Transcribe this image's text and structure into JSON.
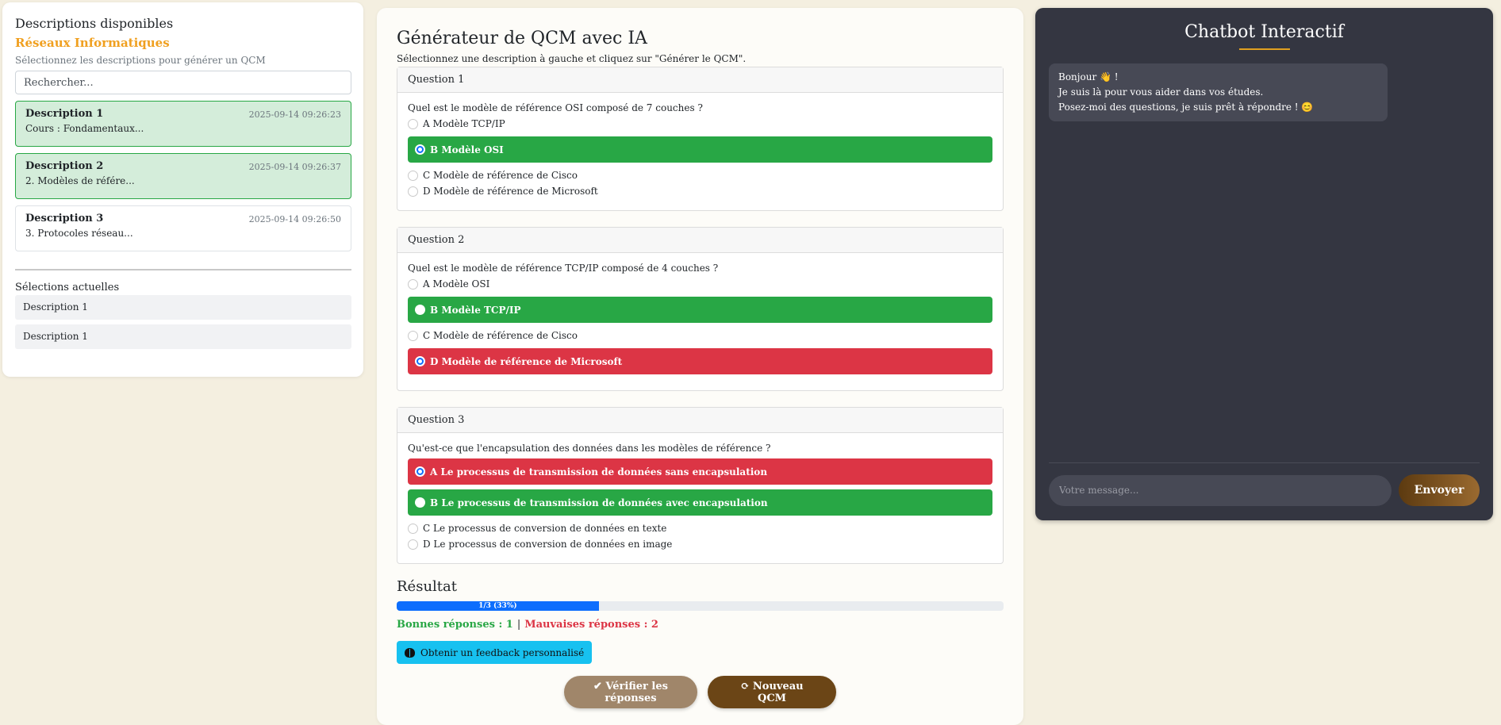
{
  "left": {
    "title": "Descriptions disponibles",
    "subject": "Réseaux Informatiques",
    "hint": "Sélectionnez les descriptions pour générer un QCM",
    "search_placeholder": "Rechercher...",
    "descriptions": [
      {
        "title": "Description 1",
        "date": "2025-09-14 09:26:23",
        "excerpt": "Cours : Fondamentaux...",
        "selected": true
      },
      {
        "title": "Description 2",
        "date": "2025-09-14 09:26:37",
        "excerpt": "2. Modèles de référe...",
        "selected": true
      },
      {
        "title": "Description 3",
        "date": "2025-09-14 09:26:50",
        "excerpt": "3. Protocoles réseau...",
        "selected": false
      }
    ],
    "selections_title": "Sélections actuelles",
    "selections": [
      "Description 1",
      "Description 1"
    ]
  },
  "qcm": {
    "title": "Générateur de QCM avec IA",
    "hint": "Sélectionnez une description à gauche et cliquez sur \"Générer le QCM\".",
    "questions": [
      {
        "header": "Question 1",
        "text": "Quel est le modèle de référence OSI composé de 7 couches ?",
        "options": [
          {
            "label": "A Modèle TCP/IP",
            "state": "none",
            "checked": false
          },
          {
            "label": "B Modèle OSI",
            "state": "green",
            "checked": true
          },
          {
            "label": "C Modèle de référence de Cisco",
            "state": "none",
            "checked": false
          },
          {
            "label": "D Modèle de référence de Microsoft",
            "state": "none",
            "checked": false
          }
        ]
      },
      {
        "header": "Question 2",
        "text": "Quel est le modèle de référence TCP/IP composé de 4 couches ?",
        "options": [
          {
            "label": "A Modèle OSI",
            "state": "none",
            "checked": false
          },
          {
            "label": "B Modèle TCP/IP",
            "state": "green",
            "checked": false
          },
          {
            "label": "C Modèle de référence de Cisco",
            "state": "none",
            "checked": false
          },
          {
            "label": "D Modèle de référence de Microsoft",
            "state": "red",
            "checked": true
          }
        ]
      },
      {
        "header": "Question 3",
        "text": "Qu'est-ce que l'encapsulation des données dans les modèles de référence ?",
        "options": [
          {
            "label": "A Le processus de transmission de données sans encapsulation",
            "state": "red",
            "checked": true
          },
          {
            "label": "B Le processus de transmission de données avec encapsulation",
            "state": "green",
            "checked": false
          },
          {
            "label": "C Le processus de conversion de données en texte",
            "state": "none",
            "checked": false
          },
          {
            "label": "D Le processus de conversion de données en image",
            "state": "none",
            "checked": false
          }
        ]
      }
    ],
    "result_title": "Résultat",
    "progress_label": "1/3 (33%)",
    "progress_fraction": 0.333,
    "good_label": "Bonnes réponses : 1",
    "separator": "|",
    "bad_label": "Mauvaises réponses : 2",
    "feedback_button": "Obtenir un feedback personnalisé",
    "verify_button": "✔ Vérifier les réponses",
    "new_button": "⟳ Nouveau QCM"
  },
  "chat": {
    "title": "Chatbot Interactif",
    "welcome_lines": [
      "Bonjour 👋 !",
      "Je suis là pour vous aider dans vos études.",
      "Posez-moi des questions, je suis prêt à répondre ! 😊"
    ],
    "input_placeholder": "Votre message...",
    "send_button": "Envoyer"
  },
  "colors": {
    "correct": "#28a745",
    "wrong": "#dc3545",
    "accent": "#f0a020",
    "progress": "#0d6efd"
  }
}
